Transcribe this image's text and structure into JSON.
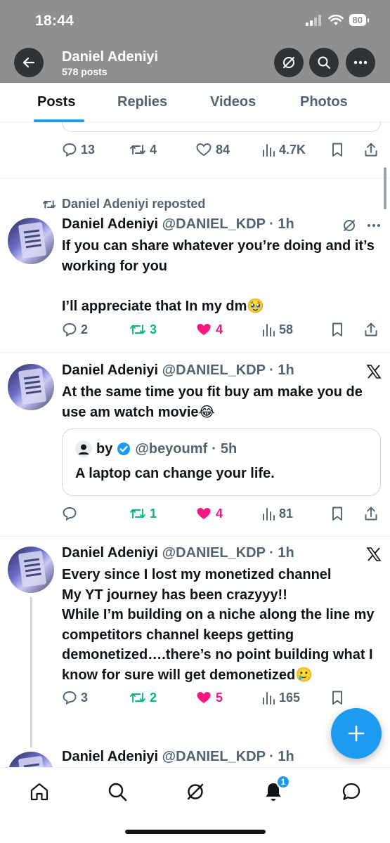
{
  "status": {
    "time": "18:44",
    "battery": "80"
  },
  "header": {
    "name": "Daniel Adeniyi",
    "posts_count": "578 posts"
  },
  "tabs": [
    {
      "label": "Posts",
      "active": true
    },
    {
      "label": "Replies"
    },
    {
      "label": "Videos"
    },
    {
      "label": "Photos"
    }
  ],
  "posts": [
    {
      "stats": {
        "replies": "13",
        "reposts": "4",
        "likes": "84",
        "views": "4.7K"
      }
    },
    {
      "repost_label": "Daniel Adeniyi reposted",
      "author": "Daniel Adeniyi",
      "handle": "@DANIEL_KDP",
      "time": "1h",
      "text": "If you can share whatever you’re doing and it’s working for you\n\nI’ll appreciate that In my dm🥹",
      "stats": {
        "replies": "2",
        "reposts": "3",
        "likes": "4",
        "views": "58"
      }
    },
    {
      "author": "Daniel Adeniyi",
      "handle": "@DANIEL_KDP",
      "time": "1h",
      "text": "At the same time you fit buy am make you de use am watch movie😂",
      "quote": {
        "name": "by",
        "handle": "@beyoumf",
        "time": "5h",
        "text": "A laptop can change your life."
      },
      "stats": {
        "replies": "",
        "reposts": "1",
        "likes": "4",
        "views": "81"
      }
    },
    {
      "author": "Daniel Adeniyi",
      "handle": "@DANIEL_KDP",
      "time": "1h",
      "text": "Every since I lost my monetized channel\nMy YT journey has been crazyyy!!\nWhile I’m building on a niche along the line my competitors channel keeps getting demonetized….there’s no point building what I know for sure will get demonetized🥲",
      "stats": {
        "replies": "3",
        "reposts": "2",
        "likes": "5",
        "views": "165"
      }
    },
    {
      "author": "Daniel Adeniyi",
      "handle": "@DANIEL_KDP",
      "time": "1h"
    }
  ],
  "nav": {
    "notifications_badge": "1"
  },
  "colors": {
    "accent": "#1d9bf0",
    "repost": "#00ba7c",
    "like": "#f91880",
    "muted": "#536471"
  }
}
